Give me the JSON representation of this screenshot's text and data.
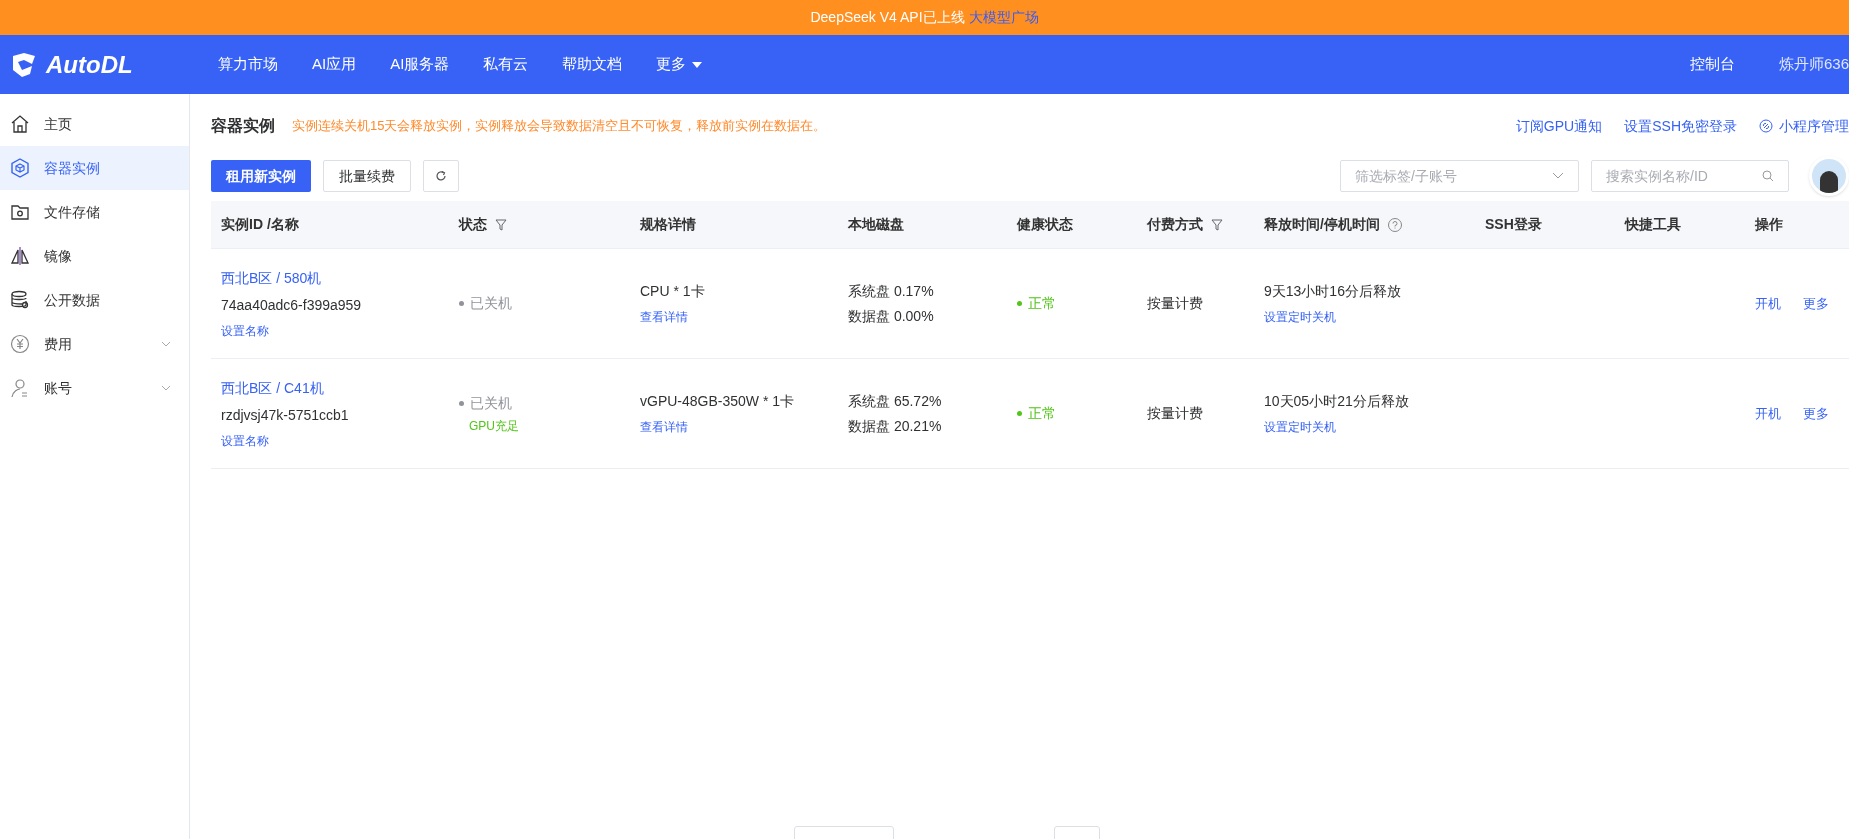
{
  "banner": {
    "text": "DeepSeek V4 API已上线",
    "link": "大模型广场"
  },
  "nav": {
    "logo": "AutoDL",
    "items": [
      {
        "label": "算力市场",
        "dropdown": false
      },
      {
        "label": "AI应用",
        "dropdown": false
      },
      {
        "label": "AI服务器",
        "dropdown": false
      },
      {
        "label": "私有云",
        "dropdown": false
      },
      {
        "label": "帮助文档",
        "dropdown": false
      },
      {
        "label": "更多",
        "dropdown": true
      }
    ],
    "right": [
      "控制台",
      "炼丹师636"
    ]
  },
  "sidebar": {
    "items": [
      {
        "label": "主页",
        "selected": false,
        "expandable": false
      },
      {
        "label": "容器实例",
        "selected": true,
        "expandable": false
      },
      {
        "label": "文件存储",
        "selected": false,
        "expandable": false
      },
      {
        "label": "镜像",
        "selected": false,
        "expandable": false
      },
      {
        "label": "公开数据",
        "selected": false,
        "expandable": false
      },
      {
        "label": "费用",
        "selected": false,
        "expandable": true
      },
      {
        "label": "账号",
        "selected": false,
        "expandable": true
      }
    ]
  },
  "page": {
    "title": "容器实例",
    "notice": "实例连续关机15天会释放实例，实例释放会导致数据清空且不可恢复，释放前实例在数据在。",
    "links": [
      {
        "label": "订阅GPU通知",
        "icon": false
      },
      {
        "label": "设置SSH免密登录",
        "icon": false
      },
      {
        "label": "小程序管理",
        "icon": true
      }
    ]
  },
  "toolbar": {
    "primary": "租用新实例",
    "secondary": "批量续费",
    "filter_placeholder": "筛选标签/子账号",
    "search_placeholder": "搜索实例名称/ID"
  },
  "table": {
    "columns": [
      {
        "label": "实例ID /名称",
        "filter": false,
        "help": false
      },
      {
        "label": "状态",
        "filter": true,
        "help": false
      },
      {
        "label": "规格详情",
        "filter": false,
        "help": false
      },
      {
        "label": "本地磁盘",
        "filter": false,
        "help": false
      },
      {
        "label": "健康状态",
        "filter": false,
        "help": false
      },
      {
        "label": "付费方式",
        "filter": true,
        "help": false
      },
      {
        "label": "释放时间/停机时间",
        "filter": false,
        "help": true
      },
      {
        "label": "SSH登录",
        "filter": false,
        "help": false
      },
      {
        "label": "快捷工具",
        "filter": false,
        "help": false
      },
      {
        "label": "操作",
        "filter": false,
        "help": false
      }
    ],
    "rows": [
      {
        "name": "西北B区 / 580机",
        "id": "74aa40adc6-f399a959",
        "rename": "设置名称",
        "status": "已关机",
        "spec": "CPU * 1卡",
        "spec_link": "查看详情",
        "disk_system": "系统盘 0.17%",
        "disk_data": "数据盘 0.00%",
        "health": "正常",
        "billing": "按量计费",
        "release": "9天13小时16分后释放",
        "timer": "设置定时关机",
        "actions": [
          "开机",
          "更多"
        ]
      },
      {
        "name": "西北B区 / C41机",
        "id": "rzdjvsj47k-5751ccb1",
        "rename": "设置名称",
        "status": "已关机",
        "status_note": "GPU充足",
        "spec": "vGPU-48GB-350W * 1卡",
        "spec_link": "查看详情",
        "disk_system": "系统盘 65.72%",
        "disk_data": "数据盘 20.21%",
        "health": "正常",
        "billing": "按量计费",
        "release": "10天05小时21分后释放",
        "timer": "设置定时关机",
        "actions": [
          "开机",
          "更多"
        ]
      }
    ]
  }
}
